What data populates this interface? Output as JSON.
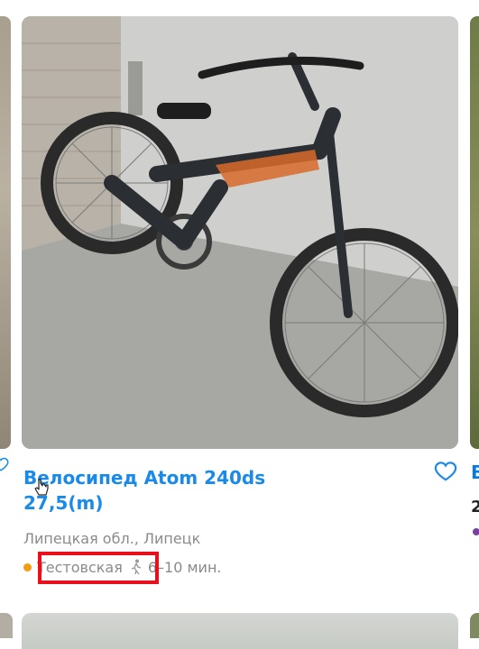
{
  "listing": {
    "title": "Велосипед Atom 240ds 27,5(m)",
    "location": "Липецкая обл., Липецк",
    "metro_station": "Тестовская",
    "walk_time": "6–10 мин.",
    "favorite_icon": "heart-outline-icon",
    "walk_icon": "walking-person-icon",
    "metro_color": "#f39c12",
    "highlight_color": "#e8101a"
  },
  "neighbor_right": {
    "title_peek": "В",
    "price_peek": "2"
  },
  "colors": {
    "title_link": "#1a8ae8",
    "muted_text": "#8a8a8a"
  }
}
